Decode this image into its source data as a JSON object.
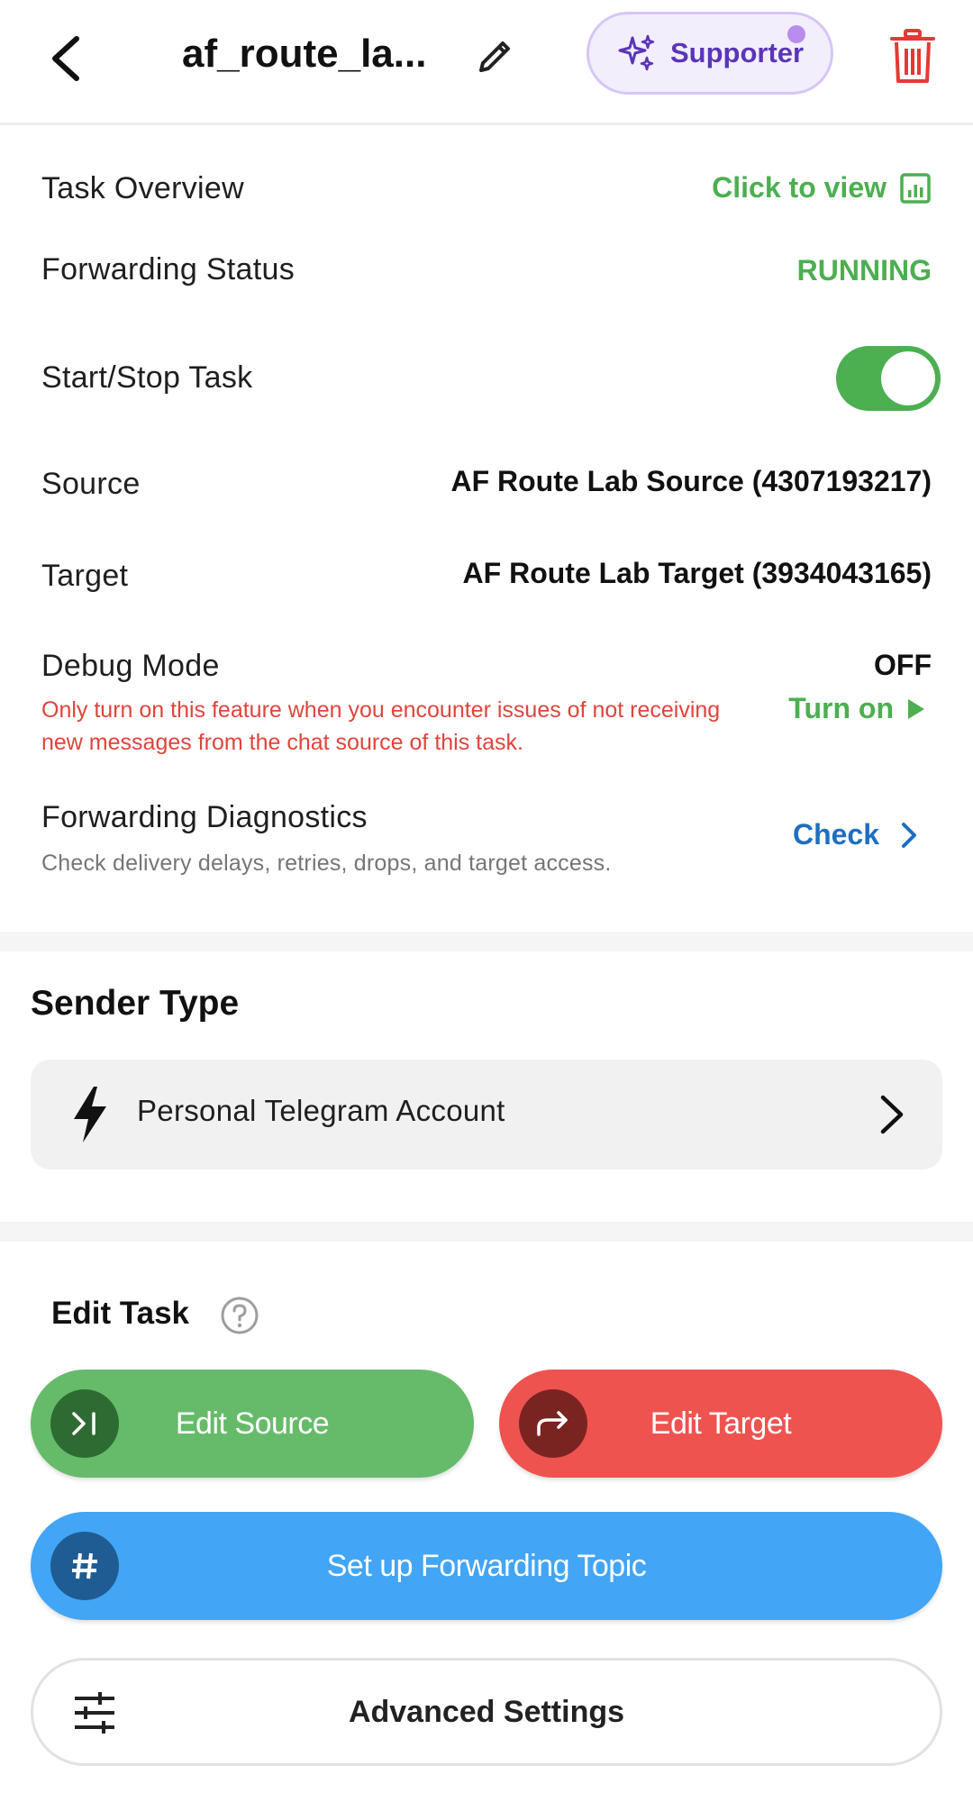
{
  "header": {
    "title": "af_route_la...",
    "supporter_label": "Supporter"
  },
  "overview": {
    "task_overview_label": "Task Overview",
    "task_overview_action": "Click to view",
    "status_label": "Forwarding Status",
    "status_value": "RUNNING",
    "start_stop_label": "Start/Stop Task",
    "toggle_on": true,
    "source_label": "Source",
    "source_value": "AF Route Lab Source (4307193217)",
    "target_label": "Target",
    "target_value": "AF Route Lab Target (3934043165)",
    "debug_label": "Debug Mode",
    "debug_value": "OFF",
    "debug_action": "Turn on",
    "debug_note": "Only turn on this feature when you encounter issues of not receiving new messages from the chat source of this task.",
    "diag_label": "Forwarding Diagnostics",
    "diag_note": "Check delivery delays, retries, drops, and target access.",
    "diag_action": "Check"
  },
  "sender": {
    "section_title": "Sender Type",
    "type_label": "Personal Telegram Account"
  },
  "edit": {
    "section_title": "Edit Task",
    "edit_source": "Edit Source",
    "edit_target": "Edit Target",
    "topic": "Set up Forwarding Topic",
    "advanced": "Advanced Settings"
  },
  "colors": {
    "green": "#4caf50",
    "red": "#ef5350",
    "blue": "#42a5f5",
    "purple": "#5a35b8"
  }
}
